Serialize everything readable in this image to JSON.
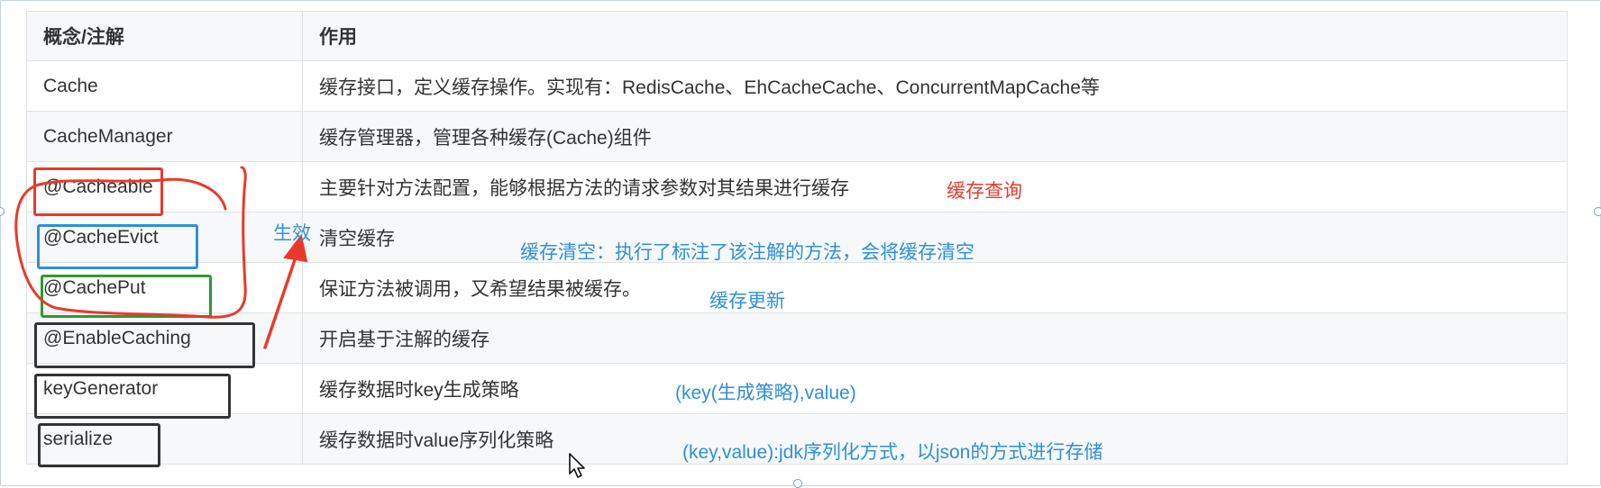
{
  "table": {
    "headers": [
      "概念/注解",
      "作用"
    ],
    "rows": [
      {
        "concept": "Cache",
        "role": "缓存接口，定义缓存操作。实现有：RedisCache、EhCacheCache、ConcurrentMapCache等"
      },
      {
        "concept": "CacheManager",
        "role": "缓存管理器，管理各种缓存(Cache)组件"
      },
      {
        "concept": "@Cacheable",
        "role": "主要针对方法配置，能够根据方法的请求参数对其结果进行缓存"
      },
      {
        "concept": "@CacheEvict",
        "role": "清空缓存"
      },
      {
        "concept": "@CachePut",
        "role": "保证方法被调用，又希望结果被缓存。"
      },
      {
        "concept": "@EnableCaching",
        "role": "开启基于注解的缓存"
      },
      {
        "concept": "keyGenerator",
        "role": "缓存数据时key生成策略"
      },
      {
        "concept": "serialize",
        "role": "缓存数据时value序列化策略"
      }
    ]
  },
  "annotations": {
    "cacheable_note": "缓存查询",
    "effect_label": "生效",
    "evict_note": "缓存清空：执行了标注了该注解的方法，会将缓存清空",
    "put_note": "缓存更新",
    "keygen_note": "(key(生成策略),value)",
    "serialize_note": "(key,value):jdk序列化方式，以json的方式进行存储"
  },
  "colors": {
    "red": "#e83a2b",
    "blue": "#2f8fd9",
    "green": "#2e9a2e",
    "dark": "#333333"
  }
}
